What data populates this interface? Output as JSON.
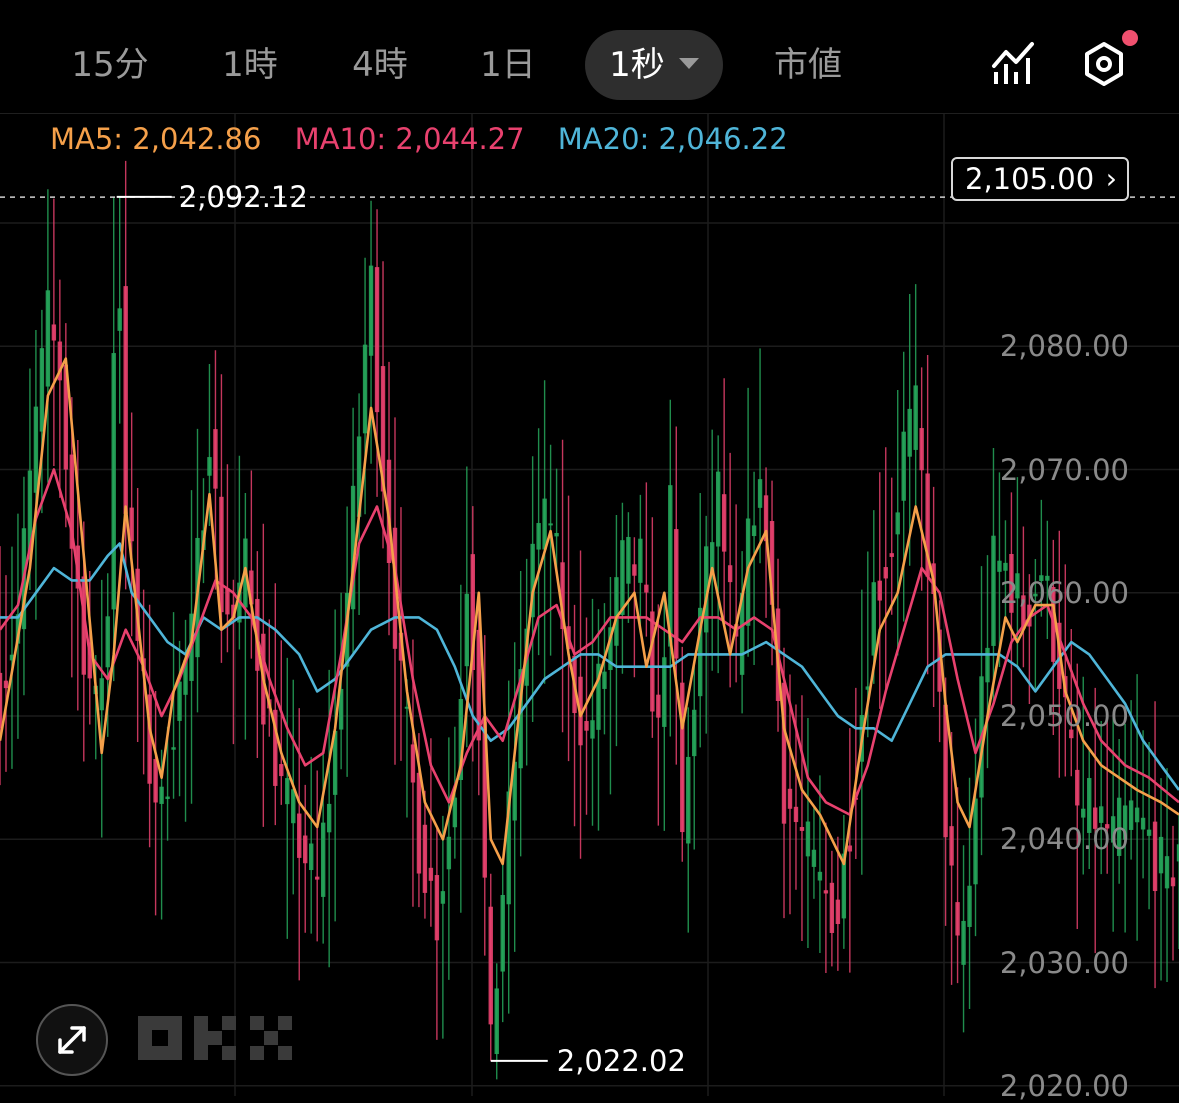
{
  "tabs": [
    {
      "label": "15分",
      "active": false
    },
    {
      "label": "1時",
      "active": false
    },
    {
      "label": "4時",
      "active": false
    },
    {
      "label": "1日",
      "active": false
    },
    {
      "label": "1秒",
      "active": true
    },
    {
      "label": "市値",
      "active": false
    }
  ],
  "icons": {
    "indicator": "indicator-chart-icon",
    "settings": "hexagon-settings-icon",
    "expand": "expand-arrows-icon",
    "logo": "okx-logo"
  },
  "colors": {
    "up": "#26a65b",
    "down": "#e8416e",
    "ma5": "#f5a04a",
    "ma10": "#e8416e",
    "ma20": "#4fb5d8"
  },
  "price_tag": "2,105.00",
  "chart_data": {
    "type": "candlestick",
    "moving_averages": [
      {
        "label": "MA5: 2,042.86",
        "color": "#f5a04a"
      },
      {
        "label": "MA10: 2,044.27",
        "color": "#e8416e"
      },
      {
        "label": "MA20: 2,046.22",
        "color": "#4fb5d8"
      }
    ],
    "y_ticks": [
      {
        "value": 2080,
        "label": "2,080.00"
      },
      {
        "value": 2070,
        "label": "2,070.00"
      },
      {
        "value": 2060,
        "label": "2,060.00"
      },
      {
        "value": 2050,
        "label": "2,050.00"
      },
      {
        "value": 2040,
        "label": "2,040.00"
      },
      {
        "value": 2030,
        "label": "2,030.00"
      },
      {
        "value": 2020,
        "label": "2,020.00"
      }
    ],
    "ylim": [
      2016.9,
      2102.9
    ],
    "x_range": [
      0,
      197
    ],
    "max_marker": {
      "index": 19.5,
      "value": 2092.12,
      "label": "2,092.12"
    },
    "min_marker": {
      "index": 82,
      "value": 2022.02,
      "label": "2,022.02"
    },
    "price_line": {
      "value": 2092.1
    },
    "ma5": [
      [
        0,
        2048
      ],
      [
        5,
        2062
      ],
      [
        8,
        2076
      ],
      [
        11,
        2079
      ],
      [
        14,
        2063
      ],
      [
        17,
        2047
      ],
      [
        19,
        2055
      ],
      [
        21,
        2067
      ],
      [
        23,
        2058
      ],
      [
        25,
        2049
      ],
      [
        27,
        2045
      ],
      [
        29,
        2052
      ],
      [
        32,
        2056
      ],
      [
        35,
        2068
      ],
      [
        37,
        2057
      ],
      [
        39,
        2058
      ],
      [
        41,
        2062
      ],
      [
        44,
        2053
      ],
      [
        47,
        2047
      ],
      [
        50,
        2043
      ],
      [
        53,
        2041
      ],
      [
        56,
        2049
      ],
      [
        59,
        2062
      ],
      [
        62,
        2075
      ],
      [
        65,
        2066
      ],
      [
        68,
        2052
      ],
      [
        71,
        2043
      ],
      [
        74,
        2040
      ],
      [
        77,
        2046
      ],
      [
        80,
        2060
      ],
      [
        82,
        2040
      ],
      [
        84,
        2038
      ],
      [
        86,
        2047
      ],
      [
        89,
        2060
      ],
      [
        92,
        2065
      ],
      [
        95,
        2055
      ],
      [
        97,
        2050
      ],
      [
        100,
        2053
      ],
      [
        103,
        2058
      ],
      [
        106,
        2060
      ],
      [
        108,
        2054
      ],
      [
        111,
        2060
      ],
      [
        114,
        2049
      ],
      [
        117,
        2057
      ],
      [
        119,
        2062
      ],
      [
        122,
        2055
      ],
      [
        125,
        2062
      ],
      [
        128,
        2065
      ],
      [
        131,
        2049
      ],
      [
        134,
        2044
      ],
      [
        137,
        2042
      ],
      [
        141,
        2038
      ],
      [
        144,
        2048
      ],
      [
        147,
        2057
      ],
      [
        150,
        2060
      ],
      [
        153,
        2067
      ],
      [
        156,
        2061
      ],
      [
        158,
        2051
      ],
      [
        160,
        2043
      ],
      [
        162,
        2041
      ],
      [
        165,
        2050
      ],
      [
        168,
        2058
      ],
      [
        170,
        2056
      ],
      [
        173,
        2059
      ],
      [
        176,
        2059
      ],
      [
        178,
        2052
      ],
      [
        181,
        2048
      ],
      [
        184,
        2046
      ],
      [
        187,
        2045
      ],
      [
        190,
        2044
      ],
      [
        194,
        2043
      ],
      [
        197,
        2042
      ]
    ],
    "ma10": [
      [
        0,
        2057
      ],
      [
        3,
        2059
      ],
      [
        6,
        2066
      ],
      [
        9,
        2070
      ],
      [
        12,
        2065
      ],
      [
        15,
        2055
      ],
      [
        18,
        2053
      ],
      [
        21,
        2057
      ],
      [
        24,
        2054
      ],
      [
        27,
        2050
      ],
      [
        30,
        2053
      ],
      [
        33,
        2057
      ],
      [
        36,
        2061
      ],
      [
        39,
        2060
      ],
      [
        42,
        2058
      ],
      [
        45,
        2053
      ],
      [
        48,
        2049
      ],
      [
        51,
        2046
      ],
      [
        54,
        2047
      ],
      [
        57,
        2055
      ],
      [
        60,
        2064
      ],
      [
        63,
        2067
      ],
      [
        66,
        2062
      ],
      [
        69,
        2053
      ],
      [
        72,
        2046
      ],
      [
        75,
        2043
      ],
      [
        78,
        2047
      ],
      [
        81,
        2050
      ],
      [
        84,
        2048
      ],
      [
        87,
        2053
      ],
      [
        90,
        2058
      ],
      [
        93,
        2059
      ],
      [
        96,
        2055
      ],
      [
        99,
        2056
      ],
      [
        102,
        2058
      ],
      [
        105,
        2058
      ],
      [
        108,
        2058
      ],
      [
        111,
        2057
      ],
      [
        114,
        2056
      ],
      [
        117,
        2058
      ],
      [
        120,
        2058
      ],
      [
        123,
        2057
      ],
      [
        126,
        2058
      ],
      [
        129,
        2057
      ],
      [
        132,
        2051
      ],
      [
        135,
        2045
      ],
      [
        138,
        2043
      ],
      [
        142,
        2042
      ],
      [
        145,
        2046
      ],
      [
        148,
        2052
      ],
      [
        151,
        2057
      ],
      [
        154,
        2062
      ],
      [
        157,
        2060
      ],
      [
        160,
        2053
      ],
      [
        163,
        2047
      ],
      [
        166,
        2051
      ],
      [
        169,
        2056
      ],
      [
        172,
        2058
      ],
      [
        175,
        2059
      ],
      [
        178,
        2055
      ],
      [
        181,
        2051
      ],
      [
        184,
        2048
      ],
      [
        188,
        2046
      ],
      [
        192,
        2045
      ],
      [
        197,
        2043
      ]
    ],
    "ma20": [
      [
        0,
        2058
      ],
      [
        3,
        2058
      ],
      [
        6,
        2060
      ],
      [
        9,
        2062
      ],
      [
        12,
        2061
      ],
      [
        15,
        2061
      ],
      [
        18,
        2063
      ],
      [
        20,
        2064
      ],
      [
        22,
        2060
      ],
      [
        25,
        2058
      ],
      [
        28,
        2056
      ],
      [
        31,
        2055
      ],
      [
        34,
        2058
      ],
      [
        37,
        2057
      ],
      [
        40,
        2058
      ],
      [
        43,
        2058
      ],
      [
        46,
        2057
      ],
      [
        50,
        2055
      ],
      [
        53,
        2052
      ],
      [
        56,
        2053
      ],
      [
        59,
        2055
      ],
      [
        62,
        2057
      ],
      [
        66,
        2058
      ],
      [
        70,
        2058
      ],
      [
        73,
        2057
      ],
      [
        76,
        2054
      ],
      [
        79,
        2050
      ],
      [
        82,
        2048
      ],
      [
        85,
        2049
      ],
      [
        88,
        2051
      ],
      [
        91,
        2053
      ],
      [
        94,
        2054
      ],
      [
        97,
        2055
      ],
      [
        100,
        2055
      ],
      [
        103,
        2054
      ],
      [
        106,
        2054
      ],
      [
        109,
        2054
      ],
      [
        112,
        2054
      ],
      [
        115,
        2055
      ],
      [
        118,
        2055
      ],
      [
        121,
        2055
      ],
      [
        124,
        2055
      ],
      [
        128,
        2056
      ],
      [
        131,
        2055
      ],
      [
        134,
        2054
      ],
      [
        137,
        2052
      ],
      [
        140,
        2050
      ],
      [
        143,
        2049
      ],
      [
        146,
        2049
      ],
      [
        149,
        2048
      ],
      [
        152,
        2051
      ],
      [
        155,
        2054
      ],
      [
        158,
        2055
      ],
      [
        161,
        2055
      ],
      [
        164,
        2055
      ],
      [
        167,
        2055
      ],
      [
        170,
        2054
      ],
      [
        173,
        2052
      ],
      [
        176,
        2054
      ],
      [
        179,
        2056
      ],
      [
        182,
        2055
      ],
      [
        185,
        2053
      ],
      [
        188,
        2051
      ],
      [
        191,
        2048
      ],
      [
        194,
        2046
      ],
      [
        197,
        2044
      ]
    ],
    "price_path": [
      [
        0,
        2052
      ],
      [
        3,
        2058
      ],
      [
        6,
        2074
      ],
      [
        8,
        2082
      ],
      [
        10,
        2078
      ],
      [
        12,
        2064
      ],
      [
        14,
        2056
      ],
      [
        16,
        2050
      ],
      [
        18,
        2058
      ],
      [
        19.5,
        2092.12
      ],
      [
        21,
        2068
      ],
      [
        23,
        2056
      ],
      [
        25,
        2046
      ],
      [
        27,
        2042
      ],
      [
        29,
        2050
      ],
      [
        32,
        2056
      ],
      [
        35,
        2074
      ],
      [
        37,
        2060
      ],
      [
        39,
        2058
      ],
      [
        41,
        2062
      ],
      [
        44,
        2052
      ],
      [
        47,
        2044
      ],
      [
        50,
        2040
      ],
      [
        53,
        2036
      ],
      [
        56,
        2048
      ],
      [
        59,
        2066
      ],
      [
        61,
        2080
      ],
      [
        62,
        2085
      ],
      [
        64,
        2070
      ],
      [
        67,
        2052
      ],
      [
        70,
        2040
      ],
      [
        73,
        2034
      ],
      [
        76,
        2044
      ],
      [
        78,
        2062
      ],
      [
        80,
        2050
      ],
      [
        82,
        2022.02
      ],
      [
        84,
        2036
      ],
      [
        87,
        2052
      ],
      [
        89,
        2064
      ],
      [
        92,
        2066
      ],
      [
        95,
        2054
      ],
      [
        98,
        2048
      ],
      [
        101,
        2054
      ],
      [
        104,
        2062
      ],
      [
        107,
        2062
      ],
      [
        110,
        2048
      ],
      [
        112,
        2066
      ],
      [
        114,
        2040
      ],
      [
        117,
        2058
      ],
      [
        120,
        2068
      ],
      [
        123,
        2054
      ],
      [
        126,
        2068
      ],
      [
        128,
        2066
      ],
      [
        131,
        2044
      ],
      [
        134,
        2040
      ],
      [
        137,
        2036
      ],
      [
        140,
        2034
      ],
      [
        143,
        2046
      ],
      [
        146,
        2060
      ],
      [
        149,
        2064
      ],
      [
        151,
        2072
      ],
      [
        153,
        2074
      ],
      [
        156,
        2058
      ],
      [
        158,
        2042
      ],
      [
        160,
        2030
      ],
      [
        162,
        2036
      ],
      [
        164,
        2052
      ],
      [
        166,
        2062
      ],
      [
        168,
        2062
      ],
      [
        171,
        2058
      ],
      [
        174,
        2062
      ],
      [
        177,
        2054
      ],
      [
        180,
        2042
      ],
      [
        183,
        2042
      ],
      [
        186,
        2040
      ],
      [
        189,
        2042
      ],
      [
        192,
        2040
      ],
      [
        195,
        2036
      ],
      [
        197,
        2040
      ]
    ]
  }
}
